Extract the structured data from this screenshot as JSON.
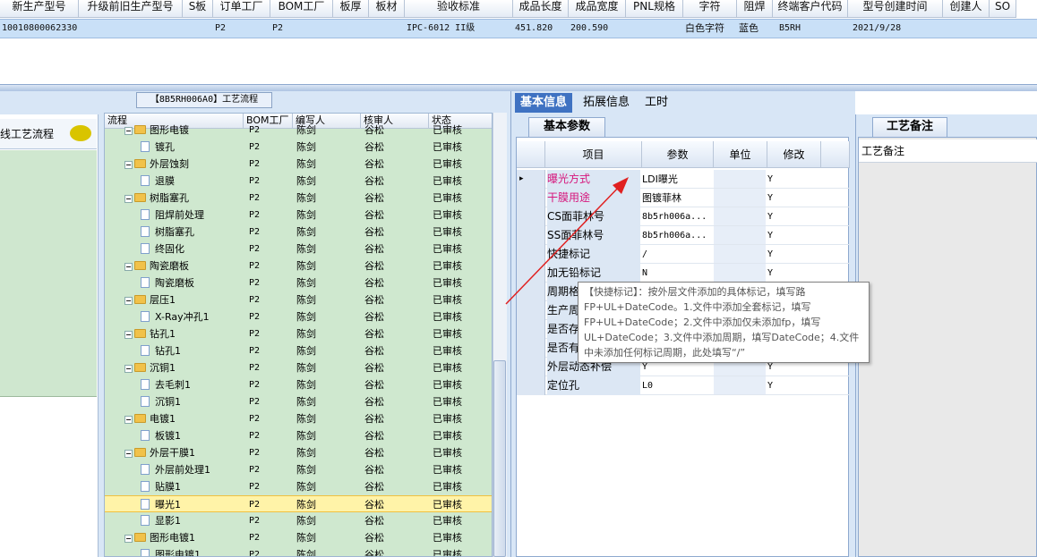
{
  "top_grid": {
    "headers": [
      "新生产型号",
      "升级前旧生产型号",
      "S板",
      "订单工厂",
      "BOM工厂",
      "板厚",
      "板材",
      "验收标准",
      "成品长度",
      "成品宽度",
      "PNL规格",
      "字符",
      "阻焊",
      "终端客户代码",
      "型号创建时间",
      "创建人",
      "SO"
    ],
    "row": [
      "10010800062330",
      "",
      "",
      "P2",
      "P2",
      "",
      "",
      "IPC-6012 II级",
      "451.820",
      "200.590",
      "",
      "白色字符",
      "蓝色",
      "B5RH",
      "2021/9/28",
      "",
      ""
    ]
  },
  "left": {
    "process_tab": "【8B5RH006A0】工艺流程",
    "sidebar_label": "线工艺流程",
    "tree_headers": [
      "流程",
      "BOM工厂",
      "编写人",
      "核审人",
      "状态"
    ],
    "rows": [
      {
        "name": "图形电镀",
        "bom": "P2",
        "writer": "陈剑",
        "checker": "谷松",
        "status": "已审核"
      },
      {
        "name": "镀孔",
        "bom": "P2",
        "writer": "陈剑",
        "checker": "谷松",
        "status": "已审核"
      },
      {
        "name": "外层蚀刻",
        "bom": "P2",
        "writer": "陈剑",
        "checker": "谷松",
        "status": "已审核"
      },
      {
        "name": "退膜",
        "bom": "P2",
        "writer": "陈剑",
        "checker": "谷松",
        "status": "已审核"
      },
      {
        "name": "树脂塞孔",
        "bom": "P2",
        "writer": "陈剑",
        "checker": "谷松",
        "status": "已审核"
      },
      {
        "name": "阻焊前处理",
        "bom": "P2",
        "writer": "陈剑",
        "checker": "谷松",
        "status": "已审核"
      },
      {
        "name": "树脂塞孔",
        "bom": "P2",
        "writer": "陈剑",
        "checker": "谷松",
        "status": "已审核"
      },
      {
        "name": "终固化",
        "bom": "P2",
        "writer": "陈剑",
        "checker": "谷松",
        "status": "已审核"
      },
      {
        "name": "陶瓷磨板",
        "bom": "P2",
        "writer": "陈剑",
        "checker": "谷松",
        "status": "已审核"
      },
      {
        "name": "陶瓷磨板",
        "bom": "P2",
        "writer": "陈剑",
        "checker": "谷松",
        "status": "已审核"
      },
      {
        "name": "层压1",
        "bom": "P2",
        "writer": "陈剑",
        "checker": "谷松",
        "status": "已审核"
      },
      {
        "name": "X-Ray冲孔1",
        "bom": "P2",
        "writer": "陈剑",
        "checker": "谷松",
        "status": "已审核"
      },
      {
        "name": "钻孔1",
        "bom": "P2",
        "writer": "陈剑",
        "checker": "谷松",
        "status": "已审核"
      },
      {
        "name": "钻孔1",
        "bom": "P2",
        "writer": "陈剑",
        "checker": "谷松",
        "status": "已审核"
      },
      {
        "name": "沉铜1",
        "bom": "P2",
        "writer": "陈剑",
        "checker": "谷松",
        "status": "已审核"
      },
      {
        "name": "去毛刺1",
        "bom": "P2",
        "writer": "陈剑",
        "checker": "谷松",
        "status": "已审核"
      },
      {
        "name": "沉铜1",
        "bom": "P2",
        "writer": "陈剑",
        "checker": "谷松",
        "status": "已审核"
      },
      {
        "name": "电镀1",
        "bom": "P2",
        "writer": "陈剑",
        "checker": "谷松",
        "status": "已审核"
      },
      {
        "name": "板镀1",
        "bom": "P2",
        "writer": "陈剑",
        "checker": "谷松",
        "status": "已审核"
      },
      {
        "name": "外层干膜1",
        "bom": "P2",
        "writer": "陈剑",
        "checker": "谷松",
        "status": "已审核"
      },
      {
        "name": "外层前处理1",
        "bom": "P2",
        "writer": "陈剑",
        "checker": "谷松",
        "status": "已审核"
      },
      {
        "name": "贴膜1",
        "bom": "P2",
        "writer": "陈剑",
        "checker": "谷松",
        "status": "已审核"
      },
      {
        "name": "曝光1",
        "bom": "P2",
        "writer": "陈剑",
        "checker": "谷松",
        "status": "已审核"
      },
      {
        "name": "显影1",
        "bom": "P2",
        "writer": "陈剑",
        "checker": "谷松",
        "status": "已审核"
      },
      {
        "name": "图形电镀1",
        "bom": "P2",
        "writer": "陈剑",
        "checker": "谷松",
        "status": "已审核"
      },
      {
        "name": "图形电镀1",
        "bom": "P2",
        "writer": "陈剑",
        "checker": "谷松",
        "status": "已审核"
      }
    ]
  },
  "mid": {
    "tabs": [
      "基本信息",
      "拓展信息",
      "工时"
    ],
    "sub_tab": "基本参数",
    "grid_headers": [
      "项目",
      "参数",
      "单位",
      "修改"
    ],
    "rows": [
      {
        "name": "曝光方式",
        "param": "LDI曝光",
        "unit": "",
        "mod": "Y"
      },
      {
        "name": "干膜用途",
        "param": "图镀菲林",
        "unit": "",
        "mod": "Y"
      },
      {
        "name": "CS面菲林号",
        "param": "8b5rh006a...",
        "unit": "",
        "mod": "Y"
      },
      {
        "name": "SS面菲林号",
        "param": "8b5rh006a...",
        "unit": "",
        "mod": "Y"
      },
      {
        "name": "快捷标记",
        "param": "/",
        "unit": "",
        "mod": "Y"
      },
      {
        "name": "加无铅标记",
        "param": "N",
        "unit": "",
        "mod": "Y"
      },
      {
        "name": "周期格",
        "param": "",
        "unit": "",
        "mod": ""
      },
      {
        "name": "生产周",
        "param": "",
        "unit": "",
        "mod": ""
      },
      {
        "name": "是否存",
        "param": "",
        "unit": "",
        "mod": ""
      },
      {
        "name": "是否有",
        "param": "",
        "unit": "",
        "mod": ""
      },
      {
        "name": "外层动态补偿",
        "param": "Y",
        "unit": "",
        "mod": "Y"
      },
      {
        "name": "定位孔",
        "param": "L0",
        "unit": "",
        "mod": "Y"
      }
    ],
    "tooltip": "【快捷标记】：按外层文件添加的具体标记，填写路FP+UL+DateCode。1.文件中添加全套标记，填写FP+UL+DateCode；2.文件中添加仅未添加fp，填写UL+DateCode；3.文件中添加周期，填写DateCode；4.文件中未添加任何标记周期，此处填写“/”"
  },
  "notes": {
    "tab": "工艺备注",
    "header": "工艺备注"
  },
  "colors": {
    "accent": "#3f72c2",
    "tree_bg": "#cfe8cf",
    "highlight": "#fff3a8",
    "pink": "#d6157b",
    "arrow": "#e02020"
  }
}
